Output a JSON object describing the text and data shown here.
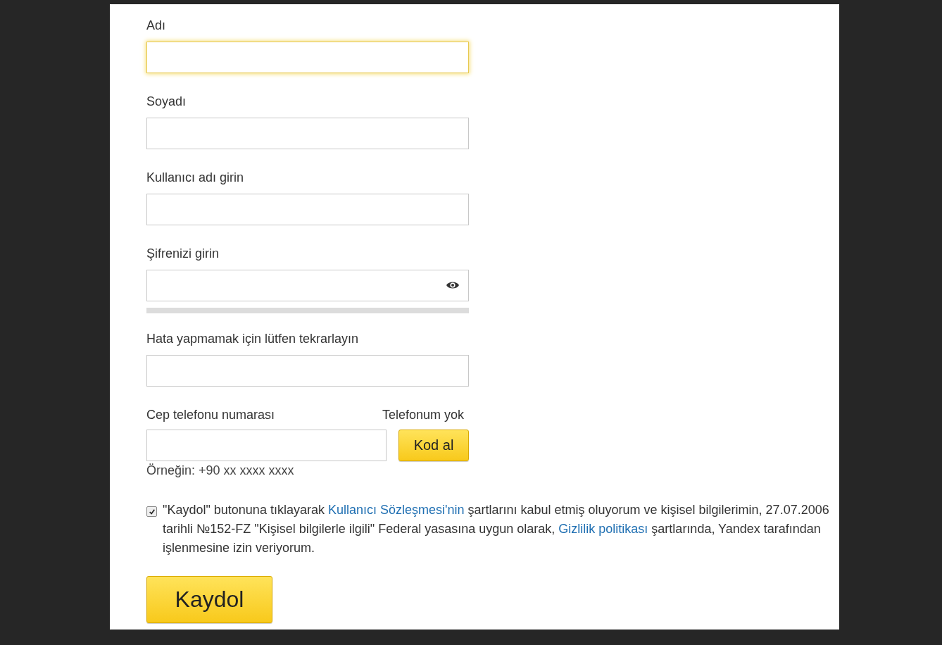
{
  "fields": [
    {
      "label": "Adı",
      "kind": "text",
      "focused": true
    },
    {
      "label": "Soyadı",
      "kind": "text",
      "focused": false
    },
    {
      "label": "Kullanıcı adı girin",
      "kind": "text",
      "focused": false
    },
    {
      "label": "Şifrenizi girin",
      "kind": "password",
      "focused": false,
      "strength": {
        "level": 0
      }
    },
    {
      "label": "Hata yapmamak için lütfen tekrarlayın",
      "kind": "text",
      "focused": false
    }
  ],
  "phone": {
    "label": "Cep telefonu numarası",
    "no_phone_link": "Telefonum yok",
    "button": "Kod al",
    "hint": "Örneğin: +90 xx xxxx xxxx"
  },
  "consent": {
    "checked": true,
    "parts": [
      {
        "kind": "text",
        "text": "\"Kaydol\" butonuna tıklayarak "
      },
      {
        "kind": "link",
        "text": "Kullanıcı Sözleşmesi'nin"
      },
      {
        "kind": "text",
        "text": " şartlarını kabul etmiş oluyorum ve kişisel bilgilerimin, 27.07.2006 tarihli №152-FZ \"Kişisel bilgilerle ilgili\" Federal yasasına uygun olarak, "
      },
      {
        "kind": "link",
        "text": "Gizlilik politikası"
      },
      {
        "kind": "text",
        "text": " şartlarında, Yandex tarafından işlenmesine izin veriyorum."
      }
    ]
  },
  "submit": "Kaydol"
}
